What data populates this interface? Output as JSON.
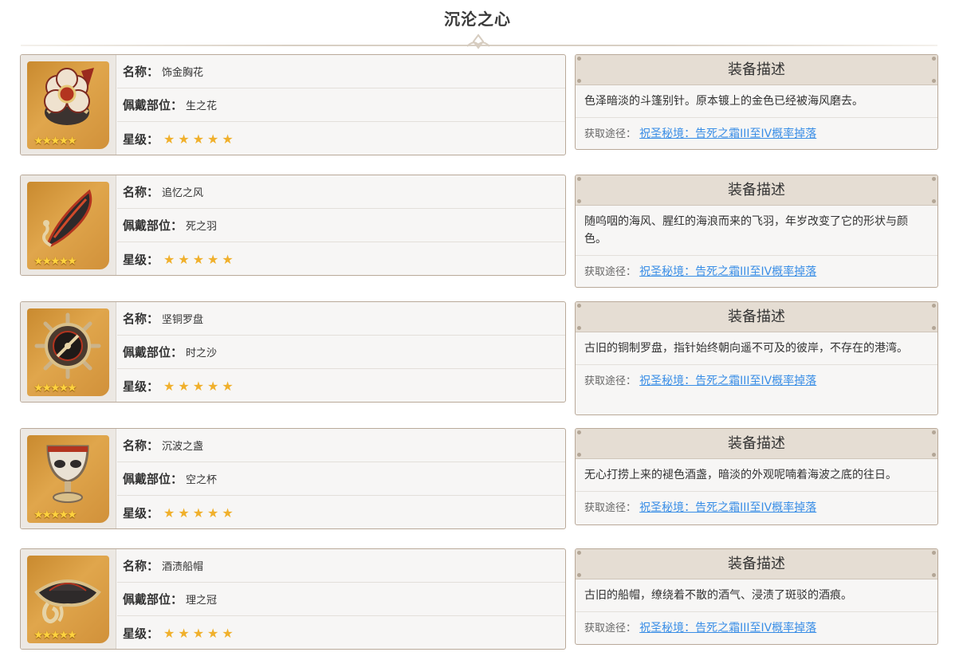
{
  "page": {
    "title": "沉沦之心"
  },
  "labels": {
    "name": "名称：",
    "slot": "佩戴部位：",
    "rarity": "星级：",
    "desc_header": "装备描述",
    "source_label": "获取途径："
  },
  "items": [
    {
      "name": "饰金胸花",
      "slot": "生之花",
      "stars": "★★★★★",
      "thumb_stars": "★★★★★",
      "icon": "flower-brooch-icon",
      "description": "色泽暗淡的斗篷别针。原本镀上的金色已经被海风磨去。",
      "source_link": "祝圣秘境：告死之霜III至IV概率掉落"
    },
    {
      "name": "追忆之风",
      "slot": "死之羽",
      "stars": "★★★★★",
      "thumb_stars": "★★★★★",
      "icon": "feather-icon",
      "description": "随呜咽的海风、腥红的海浪而来的飞羽，年岁改变了它的形状与颜色。",
      "source_link": "祝圣秘境：告死之霜III至IV概率掉落"
    },
    {
      "name": "坚铜罗盘",
      "slot": "时之沙",
      "stars": "★★★★★",
      "thumb_stars": "★★★★★",
      "icon": "compass-icon",
      "description": "古旧的铜制罗盘，指针始终朝向遥不可及的彼岸，不存在的港湾。",
      "source_link": "祝圣秘境：告死之霜III至IV概率掉落"
    },
    {
      "name": "沉波之盏",
      "slot": "空之杯",
      "stars": "★★★★★",
      "thumb_stars": "★★★★★",
      "icon": "goblet-icon",
      "description": "无心打捞上来的褪色酒盏，暗淡的外观呢喃着海波之底的往日。",
      "source_link": "祝圣秘境：告死之霜III至IV概率掉落"
    },
    {
      "name": "酒渍船帽",
      "slot": "理之冠",
      "stars": "★★★★★",
      "thumb_stars": "★★★★★",
      "icon": "tricorn-hat-icon",
      "description": "古旧的船帽，缭绕着不散的酒气、浸渍了斑驳的酒痕。",
      "source_link": "祝圣秘境：告死之霜III至IV概率掉落"
    }
  ]
}
